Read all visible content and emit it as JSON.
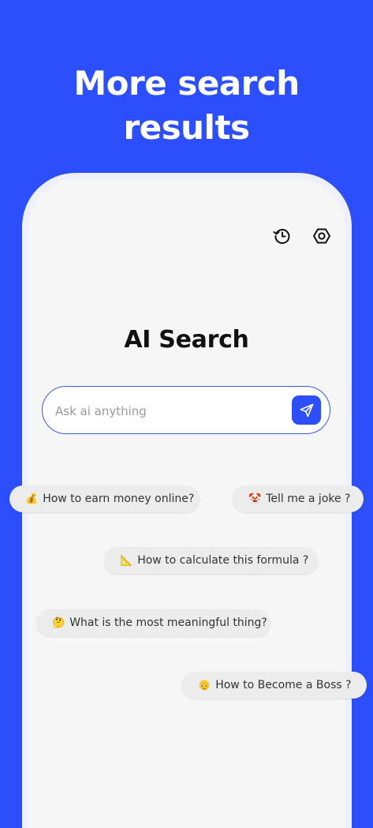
{
  "headline": {
    "line1": "More search",
    "line2": "results"
  },
  "toolbar": {
    "history_icon": "history-icon",
    "settings_icon": "settings-hexagon-icon"
  },
  "app": {
    "title": "AI Search"
  },
  "search": {
    "placeholder": "Ask ai anything",
    "value": "",
    "send_icon": "send-icon"
  },
  "suggestions": [
    {
      "emoji": "💰",
      "text": "How to earn money online?"
    },
    {
      "emoji": "🤡",
      "text": "Tell me a joke ?"
    },
    {
      "emoji": "📐",
      "text": "How to calculate this formula ?"
    },
    {
      "emoji": "🤔",
      "text": "What is the most meaningful thing?"
    },
    {
      "emoji": "👴",
      "text": " How to Become a Boss ?"
    }
  ],
  "colors": {
    "background": "#2c4ffb",
    "accent": "#2c4ffb",
    "screen": "#f6f6f6",
    "chip": "#ececec"
  }
}
